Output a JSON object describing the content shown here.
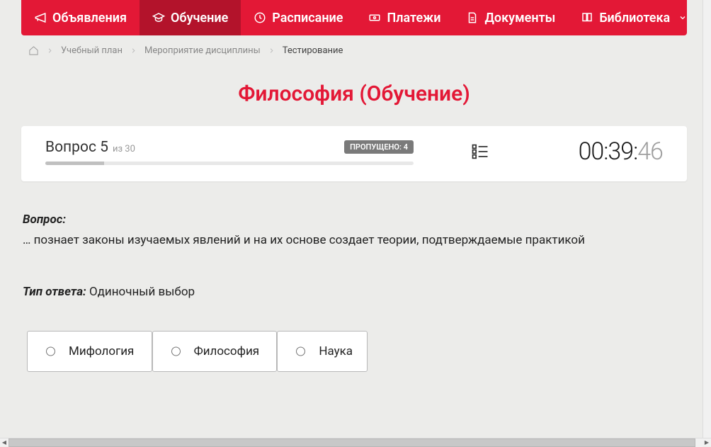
{
  "nav": {
    "items": [
      {
        "label": "Объявления",
        "icon": "megaphone-icon",
        "active": false
      },
      {
        "label": "Обучение",
        "icon": "graduation-icon",
        "active": true
      },
      {
        "label": "Расписание",
        "icon": "clock-icon",
        "active": false
      },
      {
        "label": "Платежи",
        "icon": "money-icon",
        "active": false
      },
      {
        "label": "Документы",
        "icon": "doc-icon",
        "active": false
      },
      {
        "label": "Библиотека",
        "icon": "book-icon",
        "active": false,
        "dropdown": true
      }
    ]
  },
  "breadcrumbs": {
    "items": [
      "Учебный план",
      "Мероприятие дисциплины"
    ],
    "current": "Тестирование"
  },
  "title": "Философия (Обучение)",
  "status": {
    "question_label": "Вопрос 5",
    "of_label": "из 30",
    "skipped_label": "ПРОПУЩЕНО: 4",
    "timer_main": "00:39:",
    "timer_sec": "46"
  },
  "question": {
    "label": "Вопрос:",
    "text": "… познает законы изучаемых явлений и на их основе создает теории, подтверждаемые практикой",
    "type_label": "Тип ответа:",
    "type_value": "Одиночный выбор"
  },
  "answers": [
    {
      "text": "Мифология"
    },
    {
      "text": "Философия"
    },
    {
      "text": "Наука"
    }
  ]
}
